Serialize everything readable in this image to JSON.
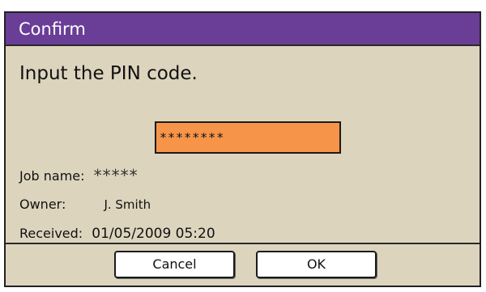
{
  "dialog": {
    "title": "Confirm",
    "prompt": "Input the PIN code.",
    "pin_value": "********",
    "fields": {
      "job_name_label": "Job name:",
      "job_name_value": "*****",
      "owner_label": "Owner:",
      "owner_value": "J. Smith",
      "received_label": "Received:",
      "received_value": "01/05/2009  05:20"
    },
    "buttons": {
      "cancel_label": "Cancel",
      "ok_label": "OK"
    },
    "colors": {
      "title_bar": "#6a3e97",
      "dialog_background": "#ddd4be",
      "pin_field_background": "#f6944a",
      "button_background": "#ffffff"
    }
  }
}
